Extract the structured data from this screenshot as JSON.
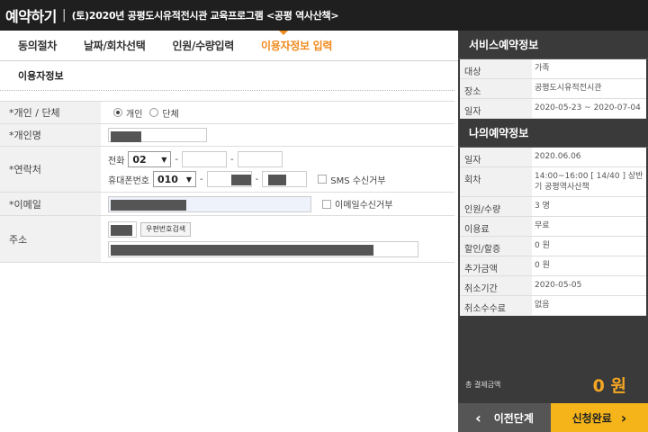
{
  "header": {
    "title": "예약하기",
    "separator": "|",
    "subtitle": "(토)2020년 공평도시유적전시관 교육프로그램 <공평 역사산책>"
  },
  "steps": [
    {
      "label": "동의절차"
    },
    {
      "label": "날짜/회차선택"
    },
    {
      "label": "인원/수량입력"
    },
    {
      "label": "이용자정보 입력",
      "active": true
    }
  ],
  "form": {
    "section_title": "이용자정보",
    "type_label": "*개인 / 단체",
    "type_options": [
      "개인",
      "단체"
    ],
    "type_selected": "개인",
    "name_label": "*개인명",
    "contact_label": "*연락처",
    "phone_label": "전화",
    "phone_prefix": "02",
    "mobile_label": "휴대폰번호",
    "mobile_prefix": "010",
    "dash": "-",
    "sms_label": "SMS 수신거부",
    "email_label": "*이메일",
    "email_optout_label": "이메일수신거부",
    "address_label": "주소",
    "postcode_button": "우편번호검색",
    "select_arrow": "▼"
  },
  "service_info": {
    "heading": "서비스예약정보",
    "rows": [
      {
        "key": "대상",
        "value": "가족"
      },
      {
        "key": "장소",
        "value": "공평도시유적전시관"
      },
      {
        "key": "일자",
        "value": "2020-05-23 ~ 2020-07-04"
      }
    ]
  },
  "my_info": {
    "heading": "나의예약정보",
    "rows": [
      {
        "key": "일자",
        "value": "2020.06.06"
      },
      {
        "key": "회차",
        "value": "14:00~16:00 [ 14/40 ] 상반기 공평역사산책"
      },
      {
        "key": "인원/수량",
        "value": "3 명"
      },
      {
        "key": "이용료",
        "value": "무료"
      },
      {
        "key": "할인/할증",
        "value": "0 원"
      },
      {
        "key": "추가금액",
        "value": "0 원"
      },
      {
        "key": "취소기간",
        "value": "2020-05-05"
      },
      {
        "key": "취소수수료",
        "value": "없음"
      }
    ]
  },
  "total": {
    "label": "총 결제금액",
    "value": "0 원"
  },
  "buttons": {
    "prev": "이전단계",
    "next": "신청완료",
    "prev_icon": "‹",
    "next_icon": "›"
  }
}
